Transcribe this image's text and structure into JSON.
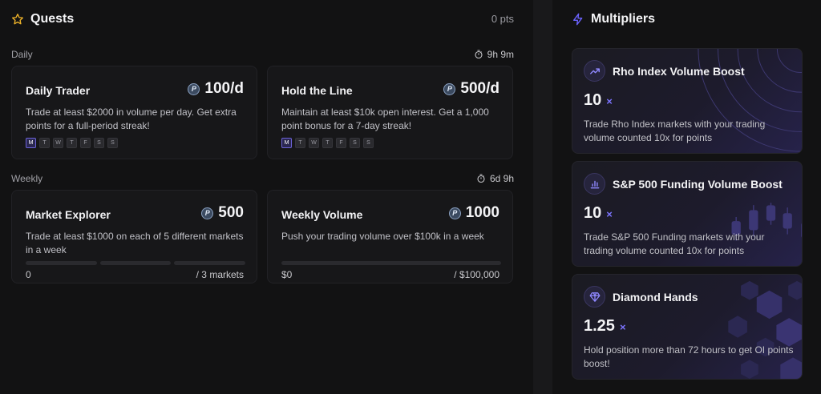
{
  "quests": {
    "title": "Quests",
    "points": "0 pts",
    "daily": {
      "label": "Daily",
      "timer": "9h 9m",
      "cards": [
        {
          "name": "Daily Trader",
          "points": "100/d",
          "description": "Trade at least $2000 in volume per day. Get extra points for a full-period streak!",
          "days": [
            "M",
            "T",
            "W",
            "T",
            "F",
            "S",
            "S"
          ]
        },
        {
          "name": "Hold the Line",
          "points": "500/d",
          "description": "Maintain at least $10k open interest. Get a 1,000 point bonus for a 7-day streak!",
          "days": [
            "M",
            "T",
            "W",
            "T",
            "F",
            "S",
            "S"
          ]
        }
      ]
    },
    "weekly": {
      "label": "Weekly",
      "timer": "6d 9h",
      "cards": [
        {
          "name": "Market Explorer",
          "points": "500",
          "description": "Trade at least $1000 on each of 5 different markets in a week",
          "progress_current": "0",
          "progress_target": "/ 3 markets"
        },
        {
          "name": "Weekly Volume",
          "points": "1000",
          "description": "Push your trading volume over $100k in a week",
          "progress_current": "$0",
          "progress_target": "/ $100,000"
        }
      ]
    }
  },
  "multipliers": {
    "title": "Multipliers",
    "accent": "#7c74ff",
    "items": [
      {
        "name": "Rho Index Volume Boost",
        "icon": "trend-up-icon",
        "value": "10",
        "suffix": "×",
        "description": "Trade Rho Index markets with your trading volume counted 10x for points"
      },
      {
        "name": "S&P 500 Funding Volume Boost",
        "icon": "bar-chart-icon",
        "value": "10",
        "suffix": "×",
        "description": "Trade S&P 500 Funding markets with your trading volume counted 10x for points"
      },
      {
        "name": "Diamond Hands",
        "icon": "diamond-icon",
        "value": "1.25",
        "suffix": "×",
        "description": "Hold position more than 72 hours to get OI points boost!"
      }
    ]
  }
}
